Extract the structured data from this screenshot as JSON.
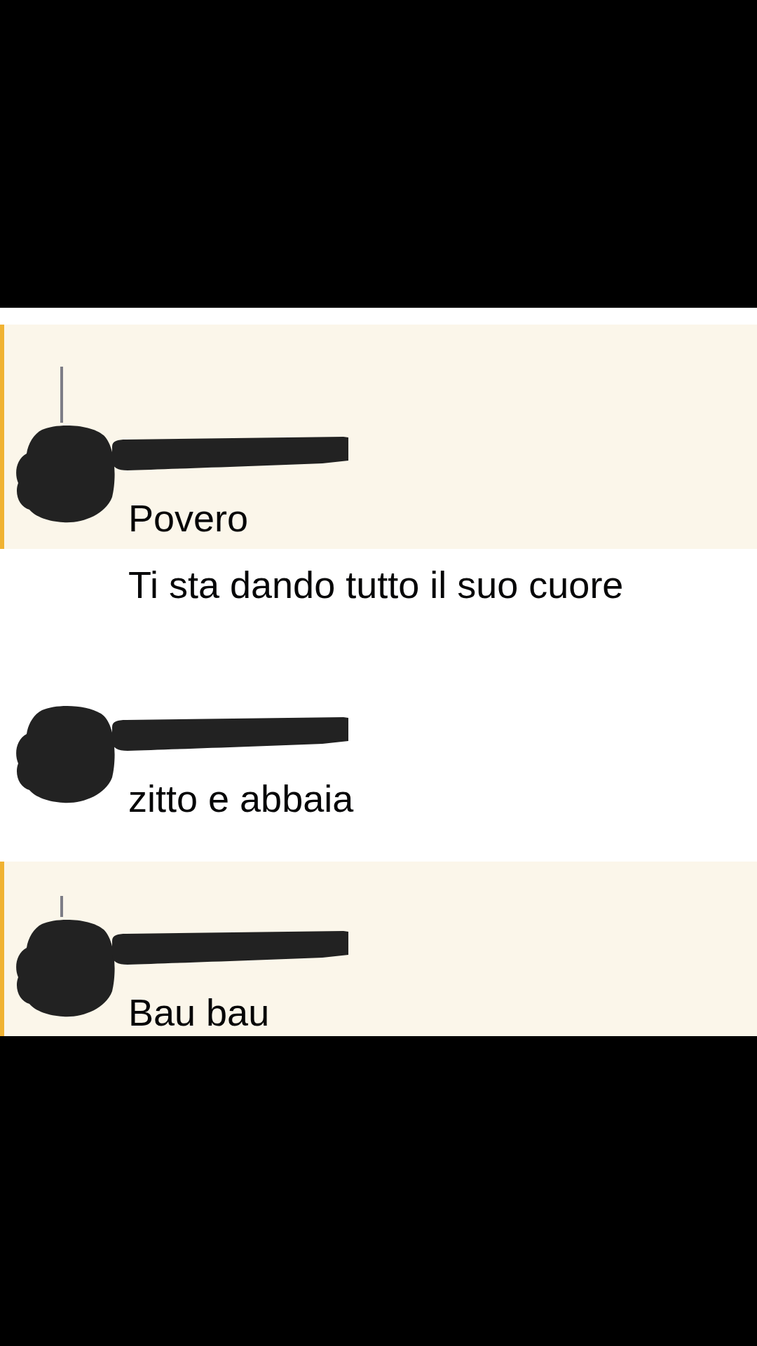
{
  "messages": [
    {
      "kind": "full",
      "mentioned": true,
      "reply": true,
      "text": "Povero"
    },
    {
      "kind": "continuation",
      "mentioned": false,
      "text": "Ti sta dando tutto il suo cuore"
    },
    {
      "kind": "full",
      "mentioned": false,
      "reply": false,
      "text": "zitto e abbaia"
    },
    {
      "kind": "full",
      "mentioned": true,
      "reply": true,
      "text": "Bau bau"
    }
  ]
}
